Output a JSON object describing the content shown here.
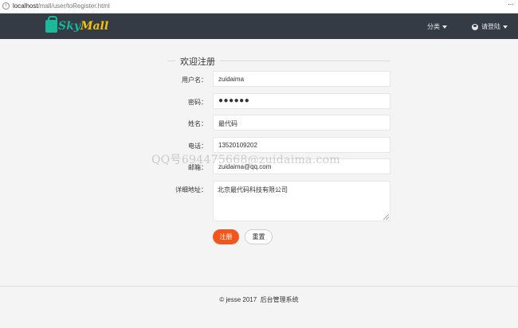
{
  "browser": {
    "url_host": "localhost",
    "url_path": "/mall/user/toRegister.html",
    "info_icon": "i",
    "more_icon": "···"
  },
  "navbar": {
    "logo": {
      "part1": "Sky",
      "part2": "Mall"
    },
    "category_label": "分类",
    "login_label": "请登陆"
  },
  "form": {
    "legend": "欢迎注册",
    "fields": [
      {
        "label": "用户名：",
        "value": "zuidaima"
      },
      {
        "label": "密码：",
        "value": "●●●●●●"
      },
      {
        "label": "姓名：",
        "value": "最代码"
      },
      {
        "label": "电话：",
        "value": "13520109202"
      },
      {
        "label": "邮箱：",
        "value": "zuidaima@qq.com"
      },
      {
        "label": "详细地址：",
        "value": "北京最代码科技有限公司"
      }
    ],
    "submit_label": "注册",
    "reset_label": "重置"
  },
  "watermark": "QQ号694475668@zuidaima.com",
  "footer": {
    "text": "© jesse 2017",
    "link": "后台管理系统"
  },
  "colors": {
    "navbar_bg": "#353b44",
    "submit_bg": "#f3561d",
    "logo_primary": "#19b59a",
    "logo_secondary": "#f4c20d"
  }
}
